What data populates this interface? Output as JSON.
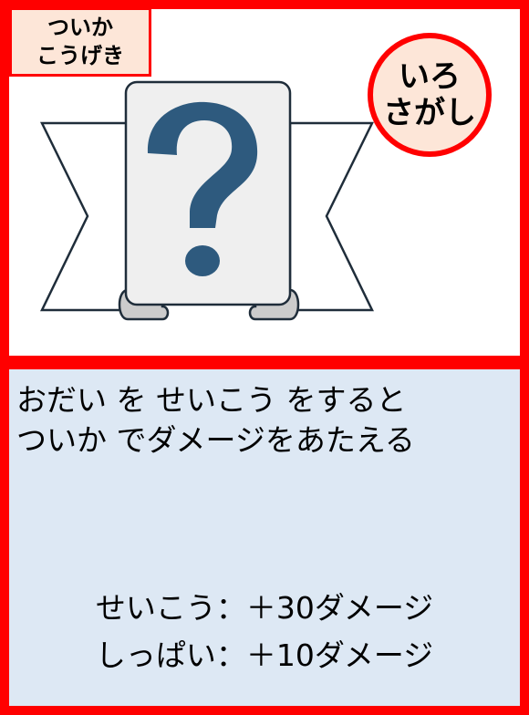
{
  "category": {
    "line1": "ついか",
    "line2": "こうげき"
  },
  "type_badge": {
    "line1": "いろ",
    "line2": "さがし"
  },
  "illustration": {
    "icon": "question-mark-banner-icon",
    "question_color": "#2e5a7e"
  },
  "description": {
    "line1": "おだい を せいこう をすると",
    "line2": "ついか でダメージをあたえる"
  },
  "results": {
    "success": "せいこう：＋30ダメージ",
    "failure": "しっぱい：＋10ダメージ"
  },
  "colors": {
    "border": "#ff0000",
    "badge_fill": "#fde6d8",
    "lower_panel": "#dde8f4"
  }
}
